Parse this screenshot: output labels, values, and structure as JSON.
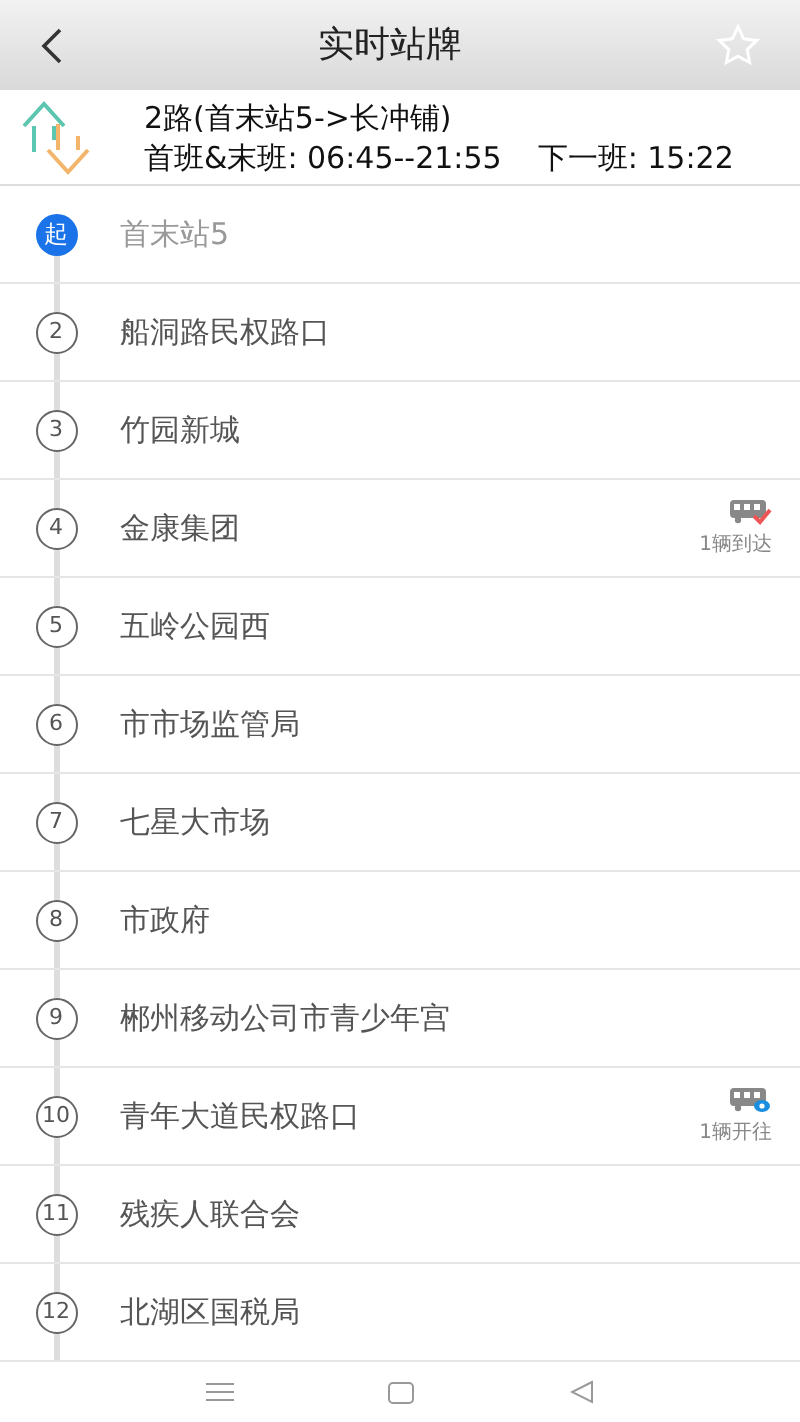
{
  "header": {
    "title": "实时站牌"
  },
  "route": {
    "name": "2路(首末站5->长冲铺)",
    "schedule": "首班&末班: 06:45--21:55",
    "next": "下一班: 15:22"
  },
  "stations": [
    {
      "marker": "起",
      "kind": "start",
      "name": "首末站5"
    },
    {
      "marker": "2",
      "kind": "stop",
      "name": "船洞路民权路口"
    },
    {
      "marker": "3",
      "kind": "stop",
      "name": "竹园新城"
    },
    {
      "marker": "4",
      "kind": "stop",
      "name": "金康集团",
      "bus": {
        "kind": "arrived",
        "text": "1辆到达"
      }
    },
    {
      "marker": "5",
      "kind": "stop",
      "name": "五岭公园西"
    },
    {
      "marker": "6",
      "kind": "stop",
      "name": "市市场监管局"
    },
    {
      "marker": "7",
      "kind": "stop",
      "name": "七星大市场"
    },
    {
      "marker": "8",
      "kind": "stop",
      "name": "市政府"
    },
    {
      "marker": "9",
      "kind": "stop",
      "name": "郴州移动公司市青少年宫"
    },
    {
      "marker": "10",
      "kind": "stop",
      "name": "青年大道民权路口",
      "bus": {
        "kind": "departing",
        "text": "1辆开往"
      }
    },
    {
      "marker": "11",
      "kind": "stop",
      "name": "残疾人联合会"
    },
    {
      "marker": "12",
      "kind": "stop",
      "name": "北湖区国税局"
    }
  ]
}
